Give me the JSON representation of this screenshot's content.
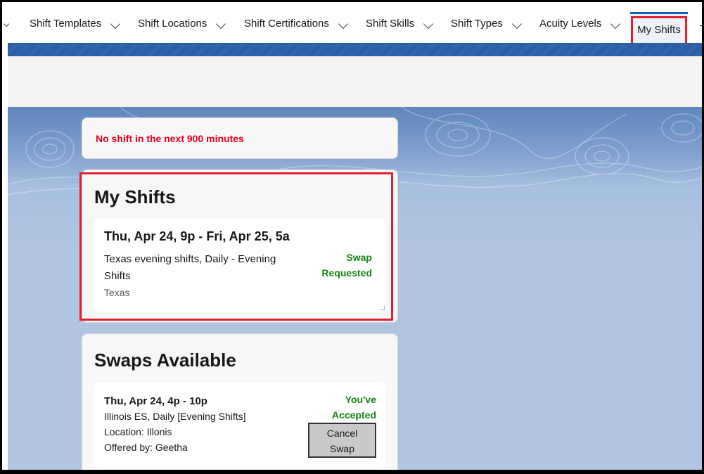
{
  "nav": {
    "items": [
      {
        "label": "Shift Templates"
      },
      {
        "label": "Shift Locations"
      },
      {
        "label": "Shift Certifications"
      },
      {
        "label": "Shift Skills"
      },
      {
        "label": "Shift Types"
      },
      {
        "label": "Acuity Levels"
      }
    ],
    "active_tab": "My Shifts",
    "cut_off_tab": "T"
  },
  "alert": {
    "message": "No shift in the next 900 minutes",
    "color": "#ea001e"
  },
  "my_shifts": {
    "title": "My Shifts",
    "shift": {
      "date_range": "Thu, Apr 24, 9p - Fri, Apr 25, 5a",
      "description": "Texas evening shifts, Daily - Evening Shifts",
      "location": "Texas",
      "status_line1": "Swap",
      "status_line2": "Requested"
    }
  },
  "swaps_available": {
    "title": "Swaps Available",
    "swap": {
      "date_range": "Thu, Apr 24, 4p - 10p",
      "description": "Illinois ES, Daily [Evening Shifts]",
      "location": "Location: Illonis",
      "offered_by": "Offered by: Geetha",
      "status_line1": "You've",
      "status_line2": "Accepted",
      "cancel_line1": "Cancel",
      "cancel_line2": "Swap"
    }
  },
  "colors": {
    "accent": "#1b5fb6",
    "highlight": "#e0202e",
    "status_green": "#168516"
  }
}
